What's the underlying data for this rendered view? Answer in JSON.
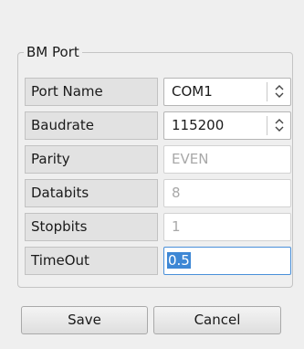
{
  "group": {
    "title": "BM Port"
  },
  "fields": [
    {
      "label": "Port Name",
      "value": "COM1",
      "kind": "combo",
      "enabled": true
    },
    {
      "label": "Baudrate",
      "value": "115200",
      "kind": "combo",
      "enabled": true
    },
    {
      "label": "Parity",
      "value": "EVEN",
      "kind": "text",
      "enabled": false
    },
    {
      "label": "Databits",
      "value": "8",
      "kind": "text",
      "enabled": false
    },
    {
      "label": "Stopbits",
      "value": "1",
      "kind": "text",
      "enabled": false
    },
    {
      "label": "TimeOut",
      "value": "0.5",
      "kind": "text",
      "enabled": true,
      "selected": true
    }
  ],
  "buttons": {
    "save": "Save",
    "cancel": "Cancel"
  },
  "icons": {
    "combo_arrow": "up-down-arrows-icon"
  }
}
